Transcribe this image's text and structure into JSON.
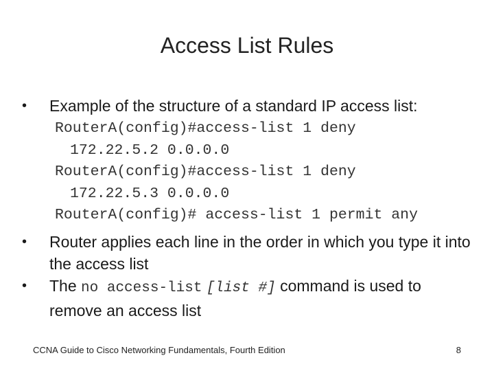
{
  "slide": {
    "title": "Access List Rules",
    "bullets": [
      {
        "text": "Example of the structure of a standard IP access list:"
      },
      {
        "text": "Router applies each line in the order in which you type it into the access list"
      },
      {
        "prefix": "The",
        "code": "no access-list",
        "code_italic": "[list #]",
        "suffix": "command is used to remove an access list"
      }
    ],
    "code_lines": [
      {
        "text": "RouterA(config)#access-list 1 deny",
        "indent": false
      },
      {
        "text": "172.22.5.2 0.0.0.0",
        "indent": true
      },
      {
        "text": "RouterA(config)#access-list 1 deny",
        "indent": false
      },
      {
        "text": "172.22.5.3 0.0.0.0",
        "indent": true
      },
      {
        "text": "RouterA(config)# access-list 1 permit any",
        "indent": false
      }
    ],
    "bullet_glyph": "•",
    "footer": "CCNA Guide to Cisco Networking Fundamentals, Fourth Edition",
    "page_number": "8"
  }
}
